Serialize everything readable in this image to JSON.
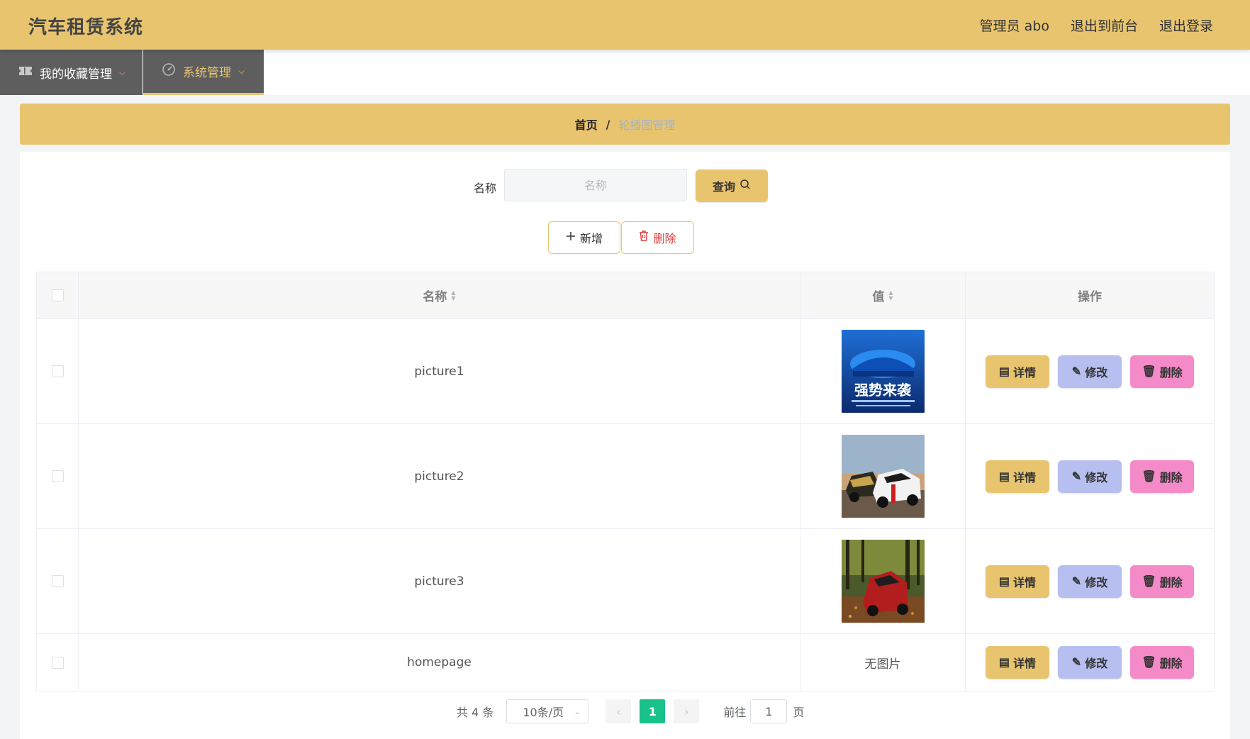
{
  "header": {
    "title": "汽车租赁系统",
    "admin_label": "管理员 abo",
    "to_front_label": "退出到前台",
    "logout_label": "退出登录"
  },
  "nav": {
    "items": [
      {
        "label": "我的收藏管理",
        "icon": "ticket-icon"
      },
      {
        "label": "系统管理",
        "icon": "dashboard-icon"
      }
    ]
  },
  "breadcrumb": {
    "home": "首页",
    "separator": "/",
    "current": "轮播图管理"
  },
  "search": {
    "label": "名称",
    "placeholder": "名称",
    "query_label": "查询"
  },
  "actions": {
    "add_label": "新增",
    "delete_label": "删除"
  },
  "table": {
    "columns": [
      "名称",
      "值",
      "操作"
    ],
    "rows": [
      {
        "name": "picture1",
        "value": "",
        "value_image": "blue-car-poster"
      },
      {
        "name": "picture2",
        "value": "",
        "value_image": "two-racing-cars"
      },
      {
        "name": "picture3",
        "value": "",
        "value_image": "red-car-in-forest"
      },
      {
        "name": "homepage",
        "value": "无图片",
        "value_image": ""
      }
    ],
    "row_actions": {
      "detail_label": "详情",
      "edit_label": "修改",
      "delete_label": "删除"
    },
    "poster_text": "强势来袭"
  },
  "pagination": {
    "total_text": "共 4 条",
    "page_size": "10条/页",
    "current_page": "1",
    "goto_label": "前往",
    "goto_value": "1",
    "page_suffix": "页"
  },
  "colors": {
    "brand": "#e8c46f",
    "nav_bg": "#5e5e5e",
    "detail": "#e8c46f",
    "edit": "#b7bff0",
    "delete": "#f58ac8",
    "active_page": "#19c18b"
  }
}
